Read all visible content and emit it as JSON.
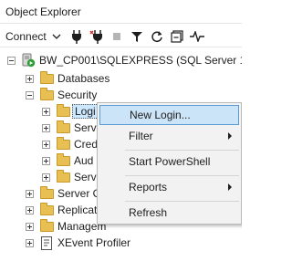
{
  "window": {
    "title": "Object Explorer"
  },
  "toolbar": {
    "connect_label": "Connect",
    "icons": [
      "connect-plug-icon",
      "disconnect-plug-icon",
      "stop-icon",
      "filter-icon",
      "refresh-icon",
      "collapse-icon",
      "activity-monitor-icon"
    ]
  },
  "tree": {
    "server": "BW_CP001\\SQLEXPRESS (SQL Server 16.0.1",
    "items": [
      {
        "label": "Databases"
      },
      {
        "label": "Security"
      },
      {
        "label": "Logi"
      },
      {
        "label": "Serv"
      },
      {
        "label": "Cred"
      },
      {
        "label": "Aud"
      },
      {
        "label": "Serv"
      },
      {
        "label": "Server O"
      },
      {
        "label": "Replicat"
      },
      {
        "label": "Managem"
      },
      {
        "label": "XEvent Profiler"
      }
    ]
  },
  "context_menu": {
    "items": [
      {
        "label": "New Login...",
        "highlighted": true
      },
      {
        "label": "Filter",
        "submenu": true
      },
      {
        "label": "Start PowerShell"
      },
      {
        "label": "Reports",
        "submenu": true
      },
      {
        "label": "Refresh"
      }
    ]
  },
  "colors": {
    "folder": "#e8bf52",
    "highlight": "#cce4f7",
    "highlight_border": "#5a9bd5",
    "server_green": "#2e9d3a"
  }
}
